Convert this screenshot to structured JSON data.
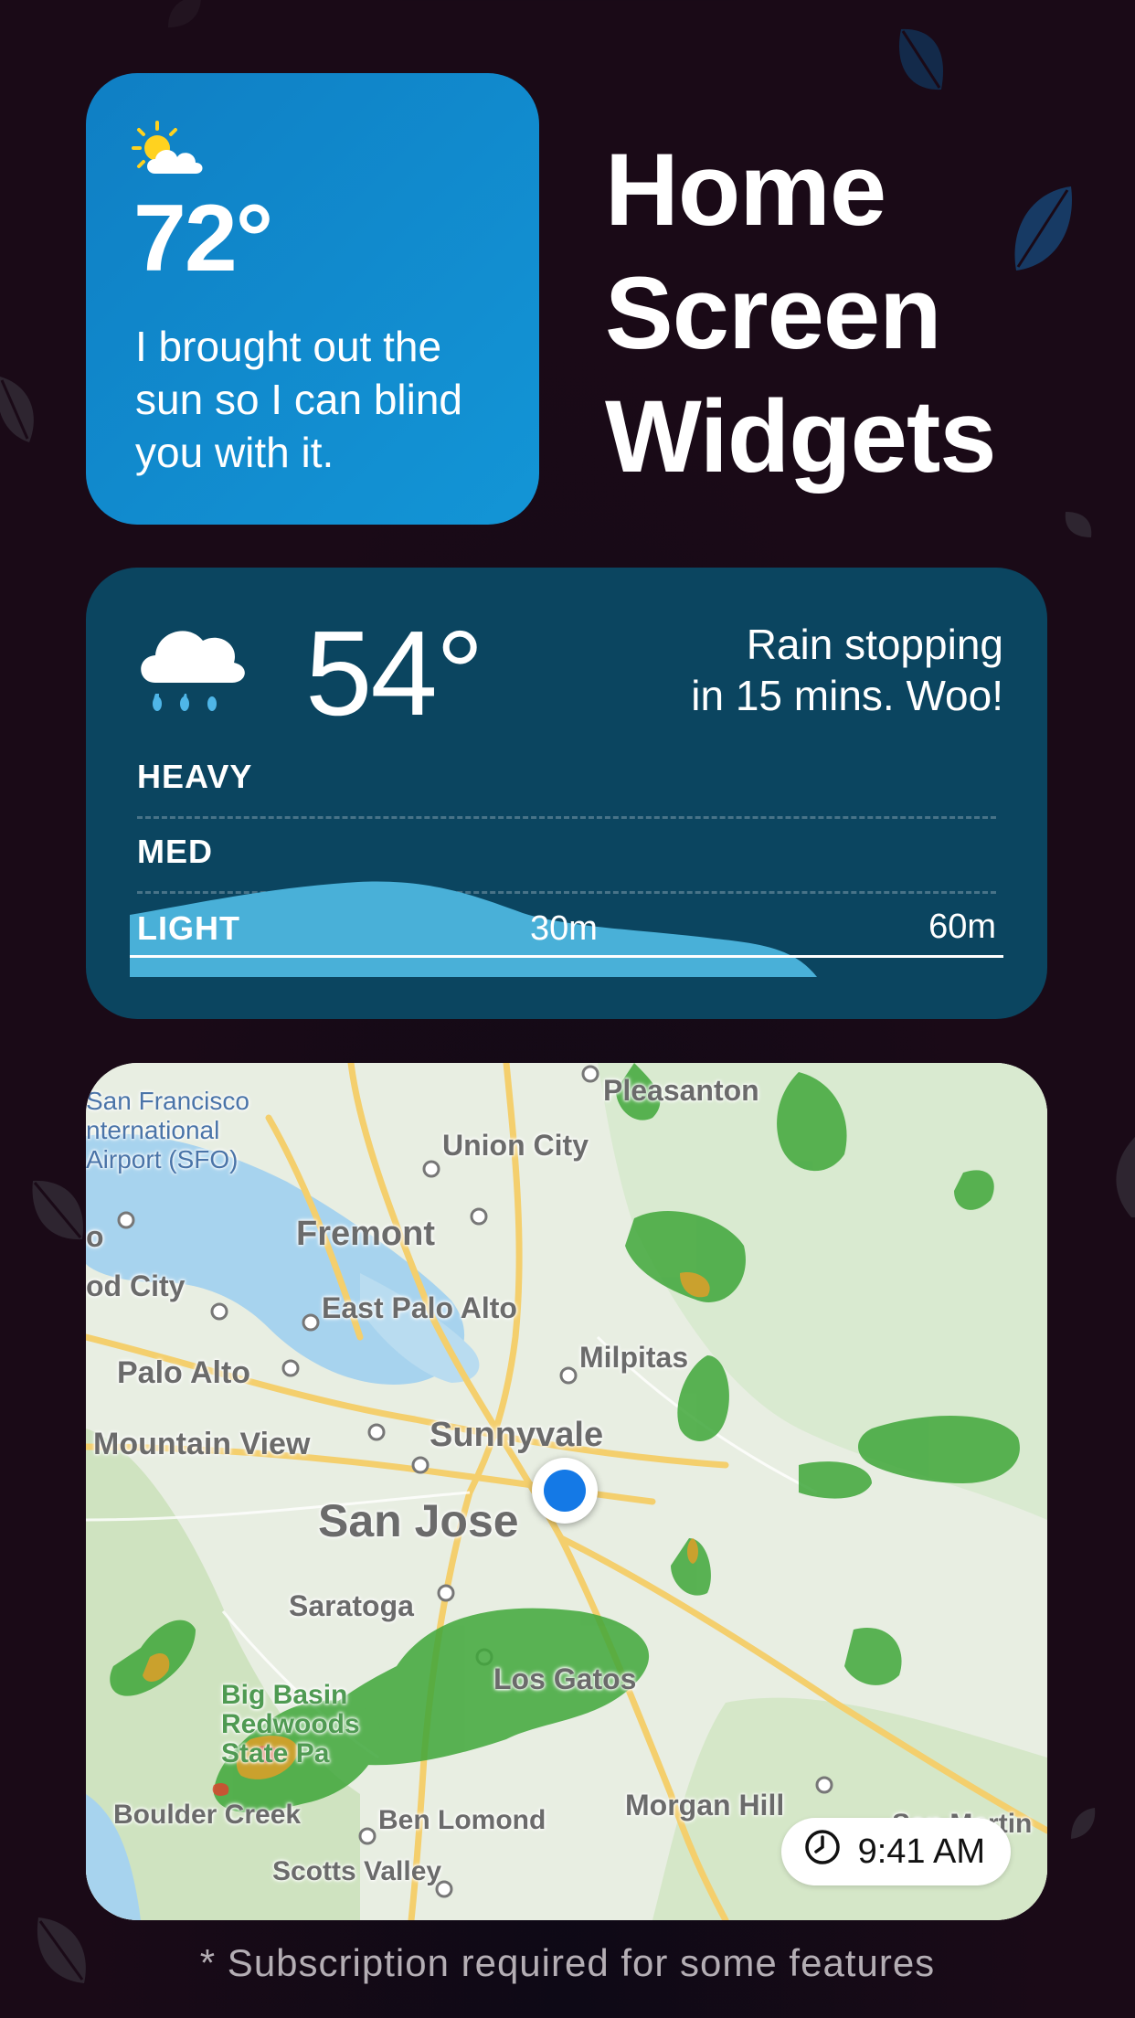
{
  "small_widget": {
    "temperature": "72°",
    "quip": "I brought out the sun so I can blind you with it.",
    "icon": "partly-sunny-icon"
  },
  "headline": {
    "line1": "Home",
    "line2": "Screen",
    "line3": "Widgets"
  },
  "rain_widget": {
    "temperature": "54°",
    "message_line1": "Rain stopping",
    "message_line2": "in 15 mins. Woo!",
    "icon": "rain-cloud-icon",
    "levels": [
      "HEAVY",
      "MED",
      "LIGHT"
    ],
    "time_ticks": [
      "30m",
      "60m"
    ],
    "intensity_color": "#49b0d8",
    "background_color": "#0b4560"
  },
  "map_widget": {
    "labels": {
      "sfo": "San Francisco International Airport (SFO)",
      "sfo1": "San Francisco",
      "sfo2": "nternational",
      "sfo3": "Airport (SFO)",
      "pleasanton": "Pleasanton",
      "union_city": "Union City",
      "fremont": "Fremont",
      "redwood_city": "od City",
      "east_palo_alto": "East Palo Alto",
      "palo_alto": "Palo Alto",
      "milpitas": "Milpitas",
      "mountain_view": "Mountain View",
      "sunnyvale": "Sunnyvale",
      "san_jose": "San Jose",
      "saratoga": "Saratoga",
      "los_gatos": "Los Gatos",
      "big_basin1": "Big Basin",
      "big_basin2": "Redwoods",
      "big_basin3": "State Pa",
      "boulder_creek": "Boulder Creek",
      "ben_lomond": "Ben Lomond",
      "morgan_hill": "Morgan Hill",
      "san_martin": "San Martin",
      "scotts_valley": "Scotts Valley",
      "edge_o": "o"
    },
    "time": "9:41 AM",
    "time_icon": "clock-icon",
    "location_icon": "current-location-icon"
  },
  "footnote": "* Subscription required for some features"
}
